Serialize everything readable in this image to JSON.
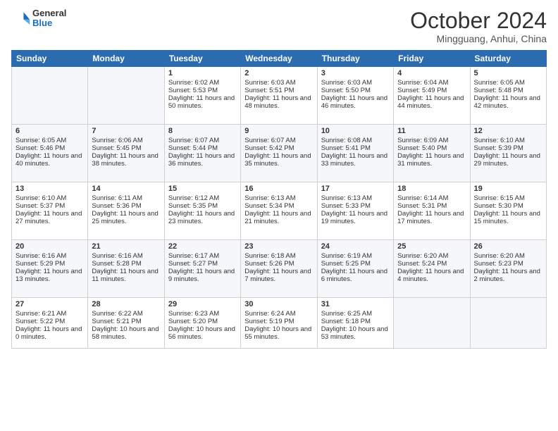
{
  "logo": {
    "general": "General",
    "blue": "Blue"
  },
  "header": {
    "month": "October 2024",
    "location": "Mingguang, Anhui, China"
  },
  "days_of_week": [
    "Sunday",
    "Monday",
    "Tuesday",
    "Wednesday",
    "Thursday",
    "Friday",
    "Saturday"
  ],
  "weeks": [
    [
      {
        "day": "",
        "sunrise": "",
        "sunset": "",
        "daylight": ""
      },
      {
        "day": "",
        "sunrise": "",
        "sunset": "",
        "daylight": ""
      },
      {
        "day": "1",
        "sunrise": "Sunrise: 6:02 AM",
        "sunset": "Sunset: 5:53 PM",
        "daylight": "Daylight: 11 hours and 50 minutes."
      },
      {
        "day": "2",
        "sunrise": "Sunrise: 6:03 AM",
        "sunset": "Sunset: 5:51 PM",
        "daylight": "Daylight: 11 hours and 48 minutes."
      },
      {
        "day": "3",
        "sunrise": "Sunrise: 6:03 AM",
        "sunset": "Sunset: 5:50 PM",
        "daylight": "Daylight: 11 hours and 46 minutes."
      },
      {
        "day": "4",
        "sunrise": "Sunrise: 6:04 AM",
        "sunset": "Sunset: 5:49 PM",
        "daylight": "Daylight: 11 hours and 44 minutes."
      },
      {
        "day": "5",
        "sunrise": "Sunrise: 6:05 AM",
        "sunset": "Sunset: 5:48 PM",
        "daylight": "Daylight: 11 hours and 42 minutes."
      }
    ],
    [
      {
        "day": "6",
        "sunrise": "Sunrise: 6:05 AM",
        "sunset": "Sunset: 5:46 PM",
        "daylight": "Daylight: 11 hours and 40 minutes."
      },
      {
        "day": "7",
        "sunrise": "Sunrise: 6:06 AM",
        "sunset": "Sunset: 5:45 PM",
        "daylight": "Daylight: 11 hours and 38 minutes."
      },
      {
        "day": "8",
        "sunrise": "Sunrise: 6:07 AM",
        "sunset": "Sunset: 5:44 PM",
        "daylight": "Daylight: 11 hours and 36 minutes."
      },
      {
        "day": "9",
        "sunrise": "Sunrise: 6:07 AM",
        "sunset": "Sunset: 5:42 PM",
        "daylight": "Daylight: 11 hours and 35 minutes."
      },
      {
        "day": "10",
        "sunrise": "Sunrise: 6:08 AM",
        "sunset": "Sunset: 5:41 PM",
        "daylight": "Daylight: 11 hours and 33 minutes."
      },
      {
        "day": "11",
        "sunrise": "Sunrise: 6:09 AM",
        "sunset": "Sunset: 5:40 PM",
        "daylight": "Daylight: 11 hours and 31 minutes."
      },
      {
        "day": "12",
        "sunrise": "Sunrise: 6:10 AM",
        "sunset": "Sunset: 5:39 PM",
        "daylight": "Daylight: 11 hours and 29 minutes."
      }
    ],
    [
      {
        "day": "13",
        "sunrise": "Sunrise: 6:10 AM",
        "sunset": "Sunset: 5:37 PM",
        "daylight": "Daylight: 11 hours and 27 minutes."
      },
      {
        "day": "14",
        "sunrise": "Sunrise: 6:11 AM",
        "sunset": "Sunset: 5:36 PM",
        "daylight": "Daylight: 11 hours and 25 minutes."
      },
      {
        "day": "15",
        "sunrise": "Sunrise: 6:12 AM",
        "sunset": "Sunset: 5:35 PM",
        "daylight": "Daylight: 11 hours and 23 minutes."
      },
      {
        "day": "16",
        "sunrise": "Sunrise: 6:13 AM",
        "sunset": "Sunset: 5:34 PM",
        "daylight": "Daylight: 11 hours and 21 minutes."
      },
      {
        "day": "17",
        "sunrise": "Sunrise: 6:13 AM",
        "sunset": "Sunset: 5:33 PM",
        "daylight": "Daylight: 11 hours and 19 minutes."
      },
      {
        "day": "18",
        "sunrise": "Sunrise: 6:14 AM",
        "sunset": "Sunset: 5:31 PM",
        "daylight": "Daylight: 11 hours and 17 minutes."
      },
      {
        "day": "19",
        "sunrise": "Sunrise: 6:15 AM",
        "sunset": "Sunset: 5:30 PM",
        "daylight": "Daylight: 11 hours and 15 minutes."
      }
    ],
    [
      {
        "day": "20",
        "sunrise": "Sunrise: 6:16 AM",
        "sunset": "Sunset: 5:29 PM",
        "daylight": "Daylight: 11 hours and 13 minutes."
      },
      {
        "day": "21",
        "sunrise": "Sunrise: 6:16 AM",
        "sunset": "Sunset: 5:28 PM",
        "daylight": "Daylight: 11 hours and 11 minutes."
      },
      {
        "day": "22",
        "sunrise": "Sunrise: 6:17 AM",
        "sunset": "Sunset: 5:27 PM",
        "daylight": "Daylight: 11 hours and 9 minutes."
      },
      {
        "day": "23",
        "sunrise": "Sunrise: 6:18 AM",
        "sunset": "Sunset: 5:26 PM",
        "daylight": "Daylight: 11 hours and 7 minutes."
      },
      {
        "day": "24",
        "sunrise": "Sunrise: 6:19 AM",
        "sunset": "Sunset: 5:25 PM",
        "daylight": "Daylight: 11 hours and 6 minutes."
      },
      {
        "day": "25",
        "sunrise": "Sunrise: 6:20 AM",
        "sunset": "Sunset: 5:24 PM",
        "daylight": "Daylight: 11 hours and 4 minutes."
      },
      {
        "day": "26",
        "sunrise": "Sunrise: 6:20 AM",
        "sunset": "Sunset: 5:23 PM",
        "daylight": "Daylight: 11 hours and 2 minutes."
      }
    ],
    [
      {
        "day": "27",
        "sunrise": "Sunrise: 6:21 AM",
        "sunset": "Sunset: 5:22 PM",
        "daylight": "Daylight: 11 hours and 0 minutes."
      },
      {
        "day": "28",
        "sunrise": "Sunrise: 6:22 AM",
        "sunset": "Sunset: 5:21 PM",
        "daylight": "Daylight: 10 hours and 58 minutes."
      },
      {
        "day": "29",
        "sunrise": "Sunrise: 6:23 AM",
        "sunset": "Sunset: 5:20 PM",
        "daylight": "Daylight: 10 hours and 56 minutes."
      },
      {
        "day": "30",
        "sunrise": "Sunrise: 6:24 AM",
        "sunset": "Sunset: 5:19 PM",
        "daylight": "Daylight: 10 hours and 55 minutes."
      },
      {
        "day": "31",
        "sunrise": "Sunrise: 6:25 AM",
        "sunset": "Sunset: 5:18 PM",
        "daylight": "Daylight: 10 hours and 53 minutes."
      },
      {
        "day": "",
        "sunrise": "",
        "sunset": "",
        "daylight": ""
      },
      {
        "day": "",
        "sunrise": "",
        "sunset": "",
        "daylight": ""
      }
    ]
  ]
}
